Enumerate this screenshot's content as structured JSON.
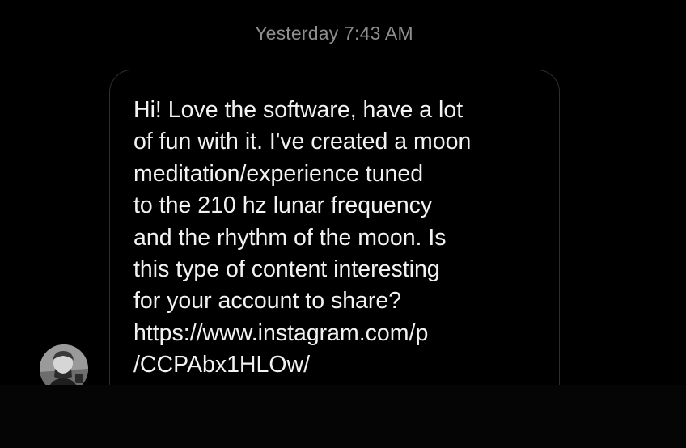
{
  "thread": {
    "timestamp": "Yesterday 7:43 AM",
    "message": {
      "text": "Hi! Love the software, have a lot\nof fun with it. I've created a moon\nmeditation/experience tuned\nto the 210 hz lunar frequency\nand the rhythm of the moon. Is\nthis type of content interesting\nfor your account to share?\nhttps://www.instagram.com/p\n/CCPAbx1HLOw/"
    },
    "sender": {
      "avatar_icon": "user-avatar-icon"
    }
  },
  "colors": {
    "background": "#000000",
    "timestamp": "#8e8e8e",
    "bubble_border": "#2f2f2f",
    "message_text": "#f2f2f2"
  }
}
